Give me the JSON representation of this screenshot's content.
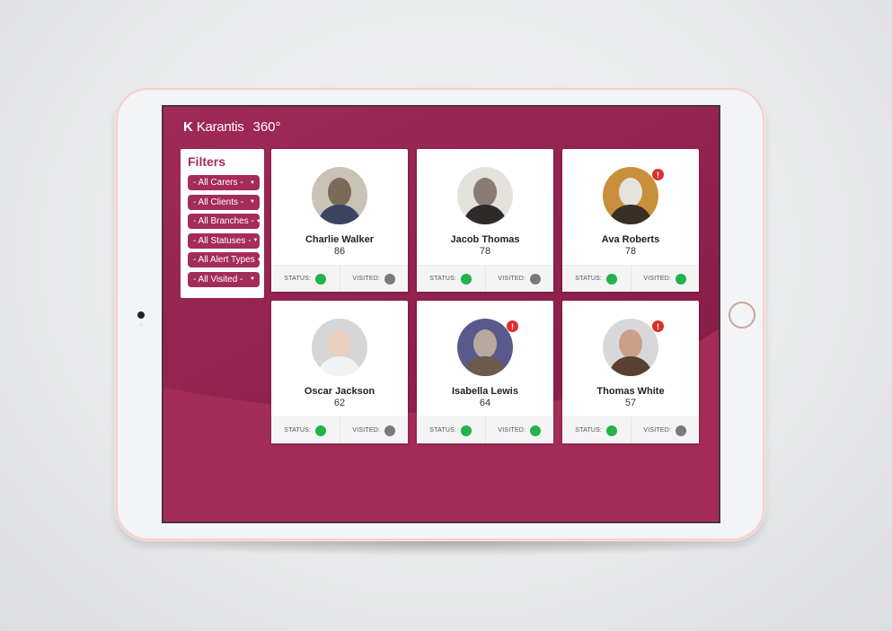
{
  "app": {
    "brand_logo": "K",
    "brand_name": "Karantis",
    "brand_suffix": "360°"
  },
  "filters": {
    "title": "Filters",
    "selects": [
      {
        "name": "carers",
        "value": "- All Carers -"
      },
      {
        "name": "clients",
        "value": "- All Clients -"
      },
      {
        "name": "branches",
        "value": "- All Branches -"
      },
      {
        "name": "statuses",
        "value": "- All Statuses -"
      },
      {
        "name": "alert-types",
        "value": "- All Alert Types"
      },
      {
        "name": "visited",
        "value": "- All Visited -"
      }
    ],
    "caret": "▼"
  },
  "labels": {
    "status": "STATUS:",
    "visited": "VISITED:",
    "alert": "!"
  },
  "colors": {
    "brand": "#a42c59",
    "brand_dark": "#8c1e48",
    "status_ok": "#22b34a",
    "status_none": "#7a7a7a",
    "alert": "#d8312f"
  },
  "clients": [
    {
      "name": "Charlie Walker",
      "age": "86",
      "alert": false,
      "status": "green",
      "visited": "grey"
    },
    {
      "name": "Jacob Thomas",
      "age": "78",
      "alert": false,
      "status": "green",
      "visited": "grey"
    },
    {
      "name": "Ava Roberts",
      "age": "78",
      "alert": true,
      "status": "green",
      "visited": "green"
    },
    {
      "name": "Oscar Jackson",
      "age": "62",
      "alert": false,
      "status": "green",
      "visited": "grey"
    },
    {
      "name": "Isabella Lewis",
      "age": "64",
      "alert": true,
      "status": "green",
      "visited": "green"
    },
    {
      "name": "Thomas White",
      "age": "57",
      "alert": true,
      "status": "green",
      "visited": "grey"
    }
  ]
}
